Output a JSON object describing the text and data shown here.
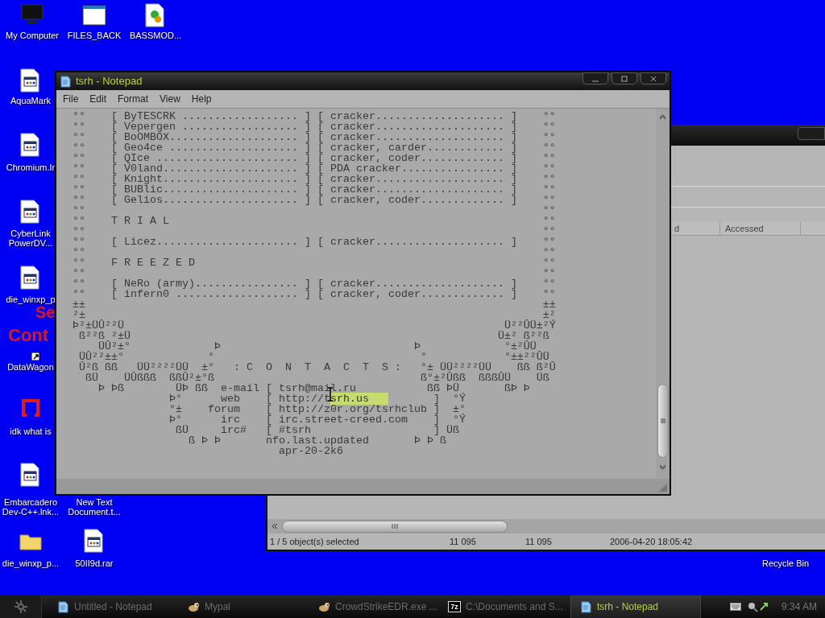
{
  "desktop": {
    "background_text": [
      "Se",
      "Cont"
    ],
    "icons": [
      {
        "label": "My Computer",
        "kind": "monitor"
      },
      {
        "label": "FILES_BACK",
        "kind": "window"
      },
      {
        "label": "BASSMOD...",
        "kind": "installer"
      },
      {
        "label": "AquaMark",
        "kind": "program"
      },
      {
        "label": "Chromium.Ir",
        "kind": "program"
      },
      {
        "label": "CyberLink\nPowerDV...",
        "kind": "program"
      },
      {
        "label": "die_winxp_p",
        "kind": "program"
      },
      {
        "label": "DataWagon",
        "kind": "shortcut"
      },
      {
        "label": "idk what is",
        "kind": "red"
      },
      {
        "label": "Embarcadero\nDev-C++.lnk...",
        "kind": "program"
      },
      {
        "label": "New Text\nDocument.t...",
        "kind": "none"
      },
      {
        "label": "die_winxp_p...",
        "kind": "folder"
      },
      {
        "label": "50II9d.rar",
        "kind": "program"
      },
      {
        "label": "Recycle Bin",
        "kind": "none"
      }
    ]
  },
  "explorer": {
    "columns": [
      {
        "label": "d"
      },
      {
        "label": "Accessed"
      }
    ],
    "status_bar": [
      "1 / 5 object(s) selected",
      "11 095",
      "11 095",
      "2006-04-20 18:05:42"
    ]
  },
  "notepad": {
    "title": "tsrh - Notepad",
    "menu": [
      "File",
      "Edit",
      "Format",
      "View",
      "Help"
    ],
    "lines": [
      {
        "segments": [
          {
            "text": "°°    [ ByTESCRK .................. ] [ cracker.................... ]    °°",
            "selected": false
          }
        ]
      },
      {
        "segments": [
          {
            "text": "°°    [ Vepergen .................. ] [ cracker.................... ]    °°",
            "selected": false
          }
        ]
      },
      {
        "segments": [
          {
            "text": "°°    [ BoOMBOX.................... ] [ cracker.................... ]    °°",
            "selected": false
          }
        ]
      },
      {
        "segments": [
          {
            "text": "°°    [ Geo4ce .................... ] [ cracker, carder............ ]    °°",
            "selected": false
          }
        ]
      },
      {
        "segments": [
          {
            "text": "°°    [ QIce ...................... ] [ cracker, coder............. ]    °°",
            "selected": false
          }
        ]
      },
      {
        "segments": [
          {
            "text": "°°    [ V0land..................... ] [ PDA cracker................ ]    °°",
            "selected": false
          }
        ]
      },
      {
        "segments": [
          {
            "text": "°°    [ Knight..................... ] [ cracker.................... ]    °°",
            "selected": false
          }
        ]
      },
      {
        "segments": [
          {
            "text": "°°    [ BUBlic..................... ] [ cracker.................... ]    °°",
            "selected": false
          }
        ]
      },
      {
        "segments": [
          {
            "text": "°°    [ Gelios..................... ] [ cracker, coder............. ]    °°",
            "selected": false
          }
        ]
      },
      {
        "segments": [
          {
            "text": "°°                                                                       °°",
            "selected": false
          }
        ]
      },
      {
        "segments": [
          {
            "text": "°°    T R I A L                                                          °°",
            "selected": false
          }
        ]
      },
      {
        "segments": [
          {
            "text": "°°                                                                       °°",
            "selected": false
          }
        ]
      },
      {
        "segments": [
          {
            "text": "°°    [ Licez...................... ] [ cracker.................... ]    °°",
            "selected": false
          }
        ]
      },
      {
        "segments": [
          {
            "text": "°°                                                                       °°",
            "selected": false
          }
        ]
      },
      {
        "segments": [
          {
            "text": "°°    F R E E Z E D                                                      °°",
            "selected": false
          }
        ]
      },
      {
        "segments": [
          {
            "text": "°°                                                                       °°",
            "selected": false
          }
        ]
      },
      {
        "segments": [
          {
            "text": "°°    [ NeRo (army)................ ] [ cracker.................... ]    °°",
            "selected": false
          }
        ]
      },
      {
        "segments": [
          {
            "text": "°°    [ infern0 ................... ] [ cracker, coder............. ]    °°",
            "selected": false
          }
        ]
      },
      {
        "segments": [
          {
            "text": "±±                                                                       ±±",
            "selected": false
          }
        ]
      },
      {
        "segments": [
          {
            "text": "²±                                                                       ±²",
            "selected": false
          }
        ]
      },
      {
        "segments": [
          {
            "text": "Þ²±ÜÛ²²Ü                                                           Ü²²ÛÜ±²Ý",
            "selected": false
          }
        ]
      },
      {
        "segments": [
          {
            "text": " ß²²ß ²±Ü                                                         Ü±² ß²²ß",
            "selected": false
          }
        ]
      },
      {
        "segments": [
          {
            "text": "    ÜÛ²±°             Þ                              Þ             °±²ÛÜ",
            "selected": false
          }
        ]
      },
      {
        "segments": [
          {
            "text": " ÜÛ²²±±°             °                                °            °±±²²ÛÜ",
            "selected": false
          }
        ]
      },
      {
        "segments": [
          {
            "text": " Û²ß ßß   ÜÜ²²²²ÜÜ  ±°   : C  O  N  T  A  C  T  S :   °± ÜÜ²²²²ÜÜ    ßß ß²Û",
            "selected": false
          }
        ]
      },
      {
        "segments": [
          {
            "text": "  ßÜ    ÜÛßßß  ßßÛ²±°ß                                ß°±²Ûßß  ßßßÛÜ    Üß",
            "selected": false
          }
        ]
      },
      {
        "segments": [
          {
            "text": "    Þ Þß        ÜÞ ßß  e-mail [ tsrh@mail.ru           ßß ÞÜ       ßÞ Þ",
            "selected": false
          }
        ]
      },
      {
        "segments": [
          {
            "text": "               Þ°      web    [ http://t",
            "selected": false
          },
          {
            "text": "srh.us   ",
            "selected": true
          },
          {
            "text": "       ]  °Ý",
            "selected": false
          }
        ]
      },
      {
        "segments": [
          {
            "text": "               °±    forum    [ http://z0r.org/tsrhclub ]  ±°",
            "selected": false
          }
        ]
      },
      {
        "segments": [
          {
            "text": "               Þ°      irc    [ irc.street-creed.com    ]  °Ý",
            "selected": false
          }
        ]
      },
      {
        "segments": [
          {
            "text": "                ßÜ     irc#   [ #tsrh                   ] Üß",
            "selected": false
          }
        ]
      },
      {
        "segments": [
          {
            "text": "                  ß Þ Þ       nfo.last.updated       Þ Þ ß",
            "selected": false
          }
        ]
      },
      {
        "segments": [
          {
            "text": "                                apr-20-2k6",
            "selected": false
          }
        ]
      }
    ]
  },
  "taskbar": {
    "items": [
      {
        "label": "Untitled - Notepad",
        "kind": "notepad",
        "selected": false
      },
      {
        "label": "Mypal",
        "kind": "animal",
        "selected": false
      },
      {
        "label": "CrowdStrikeEDR.exe ...",
        "kind": "animal",
        "selected": false
      },
      {
        "label": "C:\\Documents and S...",
        "kind": "archiver",
        "icon_text": "7z",
        "selected": false
      },
      {
        "label": "tsrh - Notepad",
        "kind": "notepad",
        "selected": true
      }
    ],
    "clock": "9:34 AM"
  }
}
